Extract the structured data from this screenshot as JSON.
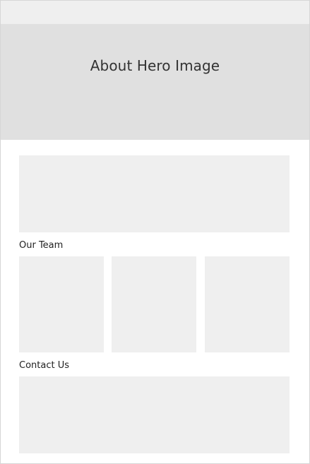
{
  "hero": {
    "title": "About Hero Image"
  },
  "sections": {
    "team_label": "Our Team",
    "contact_label": "Contact Us"
  }
}
